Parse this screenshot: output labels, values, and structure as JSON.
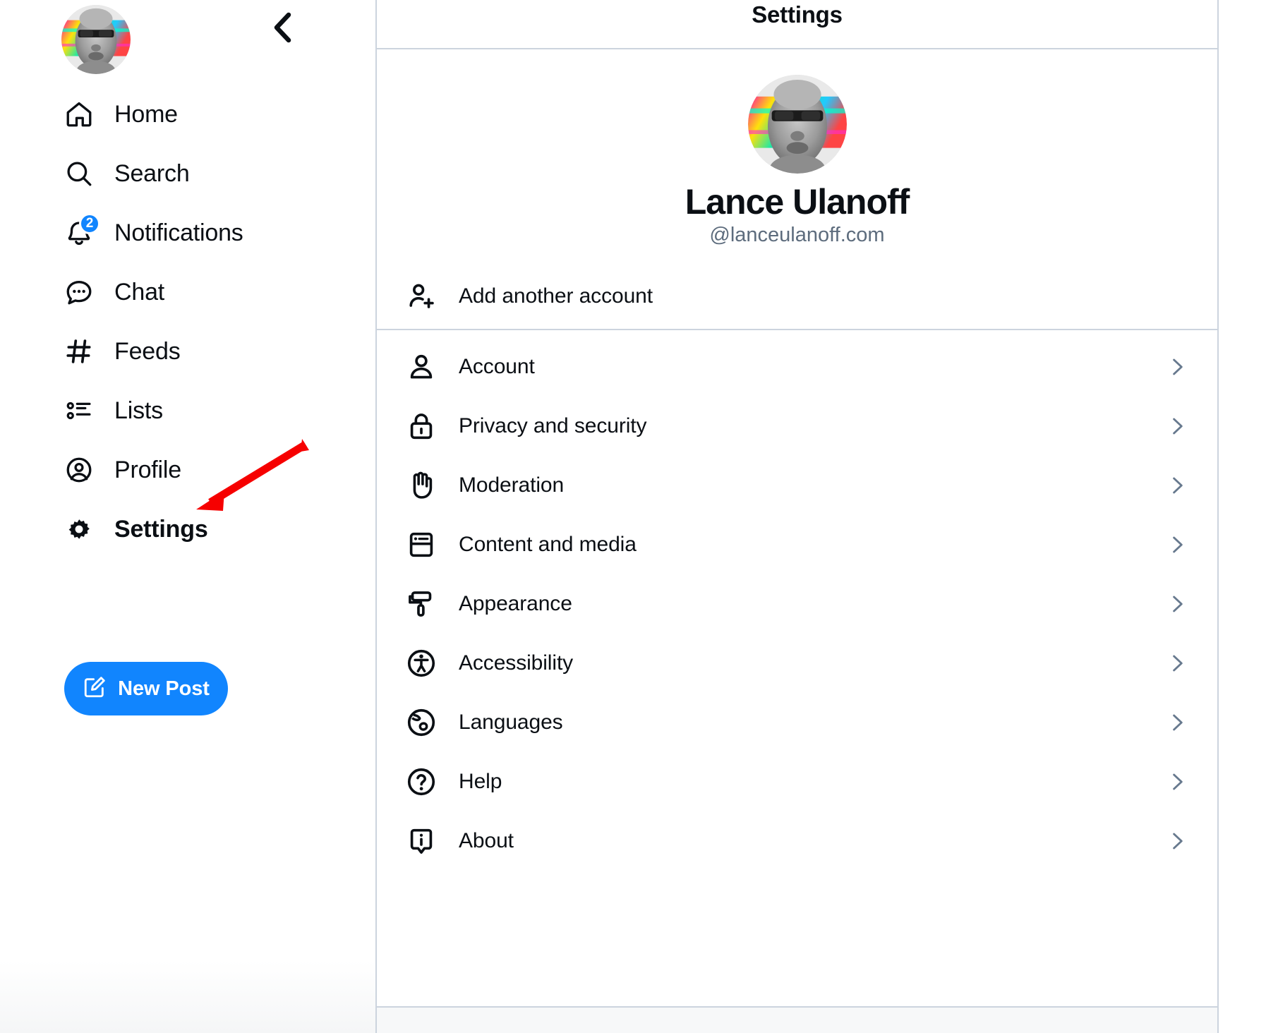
{
  "app": {
    "accent_color": "#1185fe",
    "text_color": "#0b0f14",
    "muted_color": "#5d6c7d",
    "divider_color": "#ccd4de",
    "annotation_color": "#f60000"
  },
  "sidebar": {
    "collapse_icon": "chevron-left-icon",
    "avatar_alt": "Lance Ulanoff avatar",
    "items": [
      {
        "label": "Home",
        "icon": "home-icon",
        "badge": null,
        "active": false
      },
      {
        "label": "Search",
        "icon": "search-icon",
        "badge": null,
        "active": false
      },
      {
        "label": "Notifications",
        "icon": "bell-icon",
        "badge": "2",
        "active": false
      },
      {
        "label": "Chat",
        "icon": "chat-bubble-icon",
        "badge": null,
        "active": false
      },
      {
        "label": "Feeds",
        "icon": "hashtag-icon",
        "badge": null,
        "active": false
      },
      {
        "label": "Lists",
        "icon": "list-icon",
        "badge": null,
        "active": false
      },
      {
        "label": "Profile",
        "icon": "user-circle-icon",
        "badge": null,
        "active": false
      },
      {
        "label": "Settings",
        "icon": "gear-icon",
        "badge": null,
        "active": true
      }
    ],
    "new_post": {
      "label": "New Post",
      "icon": "compose-icon"
    }
  },
  "panel": {
    "title": "Settings",
    "profile": {
      "display_name": "Lance Ulanoff",
      "handle": "@lanceulanoff.com"
    },
    "add_account": {
      "label": "Add another account",
      "icon": "user-plus-icon"
    },
    "settings_items": [
      {
        "label": "Account",
        "icon": "user-icon",
        "chevron": "chevron-right-icon"
      },
      {
        "label": "Privacy and security",
        "icon": "lock-icon",
        "chevron": "chevron-right-icon"
      },
      {
        "label": "Moderation",
        "icon": "hand-icon",
        "chevron": "chevron-right-icon"
      },
      {
        "label": "Content and media",
        "icon": "window-icon",
        "chevron": "chevron-right-icon"
      },
      {
        "label": "Appearance",
        "icon": "paint-roller-icon",
        "chevron": "chevron-right-icon"
      },
      {
        "label": "Accessibility",
        "icon": "accessibility-icon",
        "chevron": "chevron-right-icon"
      },
      {
        "label": "Languages",
        "icon": "globe-icon",
        "chevron": "chevron-right-icon"
      },
      {
        "label": "Help",
        "icon": "question-mark-icon",
        "chevron": "chevron-right-icon"
      },
      {
        "label": "About",
        "icon": "info-icon",
        "chevron": "chevron-right-icon"
      }
    ]
  },
  "annotation": {
    "type": "red-arrow",
    "points_at": "Settings"
  }
}
